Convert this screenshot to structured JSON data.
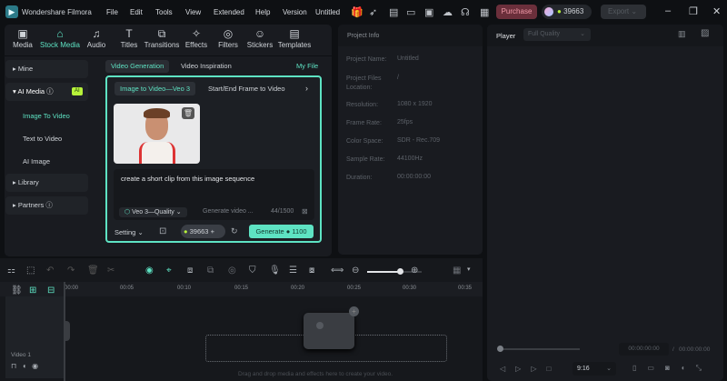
{
  "app": {
    "title": "Wondershare Filmora",
    "project": "Untitled"
  },
  "menu": [
    "File",
    "Edit",
    "Tools",
    "View",
    "Extended",
    "Help",
    "Version"
  ],
  "topbar": {
    "purchase": "Purchase",
    "credits": "39663",
    "export": "Export"
  },
  "media_tabs": [
    {
      "label": "Media",
      "icon": "media-icon"
    },
    {
      "label": "Stock Media",
      "icon": "stock-icon"
    },
    {
      "label": "Audio",
      "icon": "music-icon"
    },
    {
      "label": "Titles",
      "icon": "text-icon"
    },
    {
      "label": "Transitions",
      "icon": "transition-icon"
    },
    {
      "label": "Effects",
      "icon": "effects-icon"
    },
    {
      "label": "Filters",
      "icon": "filter-icon"
    },
    {
      "label": "Stickers",
      "icon": "sticker-icon"
    },
    {
      "label": "Templates",
      "icon": "template-icon"
    }
  ],
  "sidebar": {
    "mine": "Mine",
    "ai_media": "AI Media",
    "ai_badge": "AI",
    "image_to_video": "Image To Video",
    "text_to_video": "Text to Video",
    "ai_image": "AI Image",
    "library": "Library",
    "partners": "Partners"
  },
  "generation": {
    "tab_generation": "Video Generation",
    "tab_inspiration": "Video Inspiration",
    "my_file": "My File",
    "mode_active": "Image to Video—Veo 3",
    "mode_other": "Start/End Frame to Video",
    "prompt": "create a short clip from this image sequence",
    "model": "Veo 3—Quality",
    "placeholder": "Generate video ...",
    "char_count": "44/1500",
    "setting": "Setting",
    "credits": "39663",
    "generate": "Generate",
    "cost": "1100"
  },
  "project_info": {
    "title": "Project Info",
    "rows": [
      {
        "label": "Project Name:",
        "value": "Untitled"
      },
      {
        "label": "Project Files Location:",
        "value": "/"
      },
      {
        "label": "Resolution:",
        "value": "1080 x 1920"
      },
      {
        "label": "Frame Rate:",
        "value": "25fps"
      },
      {
        "label": "Color Space:",
        "value": "SDR - Rec.709"
      },
      {
        "label": "Sample Rate:",
        "value": "44100Hz"
      },
      {
        "label": "Duration:",
        "value": "00:00:00:00"
      }
    ]
  },
  "player": {
    "label": "Player",
    "quality": "Full Quality",
    "current_time": "00:00:00:00",
    "total_time": "00:00:00:00",
    "aspect": "9:16",
    "progress": 0
  },
  "timeline": {
    "ticks": [
      "00:00",
      "00:05",
      "00:10",
      "00:15",
      "00:20",
      "00:25",
      "00:30",
      "00:35"
    ],
    "track": "Video 1",
    "drop_hint": "Drag and drop media and effects here to create your video.",
    "zoom_level": 0.6
  },
  "colors": {
    "accent": "#5ee3c3",
    "purchase": "#6b2f3b",
    "background": "#0e1013"
  }
}
